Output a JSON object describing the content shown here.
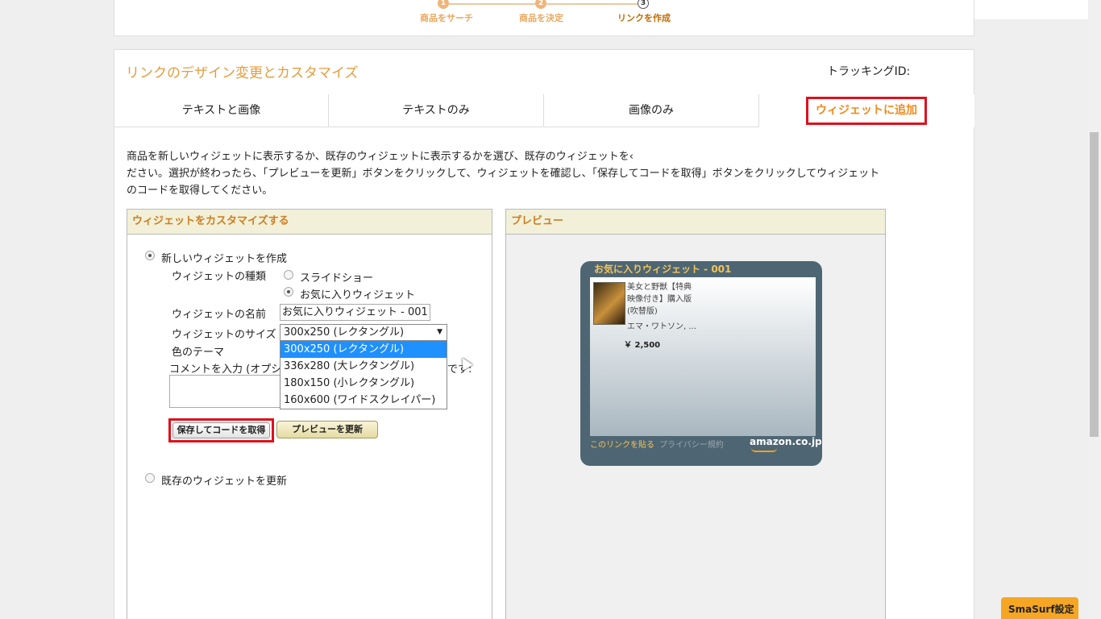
{
  "steps": [
    {
      "num": "1",
      "label": "商品をサーチ"
    },
    {
      "num": "2",
      "label": "商品を決定"
    },
    {
      "num": "3",
      "label": "リンクを作成"
    }
  ],
  "header": {
    "title": "リンクのデザイン変更とカスタマイズ",
    "tracking_label": "トラッキングID:"
  },
  "tabs": [
    {
      "label": "テキストと画像"
    },
    {
      "label": "テキストのみ"
    },
    {
      "label": "画像のみ"
    },
    {
      "label": "ウィジェットに追加"
    }
  ],
  "description": {
    "line1": "商品を新しいウィジェットに表示するか、既存のウィジェットに表示するかを選び、既存のウィジェットを‹",
    "line2": "ださい。選択が終わったら、「プレビューを更新」ボタンをクリックして、ウィジェットを確認し、「保存してコードを取得」ボタンをクリックしてウィジェット",
    "line3": "のコードを取得してください。"
  },
  "customize": {
    "title": "ウィジェットをカスタマイズする",
    "new_widget": "新しいウィジェットを作成",
    "type_label": "ウィジェットの種類",
    "type_options": [
      "スライドショー",
      "お気に入りウィジェット"
    ],
    "name_label": "ウィジェットの名前",
    "name_value": "お気に入りウィジェット - 001",
    "size_label": "ウィジェットのサイズ",
    "size_selected": "300x250 (レクタングル)",
    "size_options": [
      "300x250 (レクタングル)",
      "336x280 (大レクタングル)",
      "180x150 (小レクタングル)",
      "160x600 (ワイドスクレイパー)"
    ],
    "theme_label": "色のテーマ",
    "comment_label": "コメントを入力 (オプシ",
    "comment_suffix": "です:",
    "save_button": "保存してコードを取得",
    "preview_button": "プレビューを更新",
    "existing_widget": "既存のウィジェットを更新"
  },
  "preview": {
    "title": "プレビュー",
    "widget_title": "お気に入りウィジェット - 001",
    "product_line1": "美女と野獣【特典",
    "product_line2": "映像付き】購入版",
    "product_line3": "(吹替版)",
    "author": "エマ・ワトソン, ...",
    "price": "￥ 2,500",
    "paste_link": "このリンクを貼る",
    "privacy": "プライバシー規約",
    "logo": "amazon.co.jp"
  },
  "smasurf": "SmaSurf設定"
}
